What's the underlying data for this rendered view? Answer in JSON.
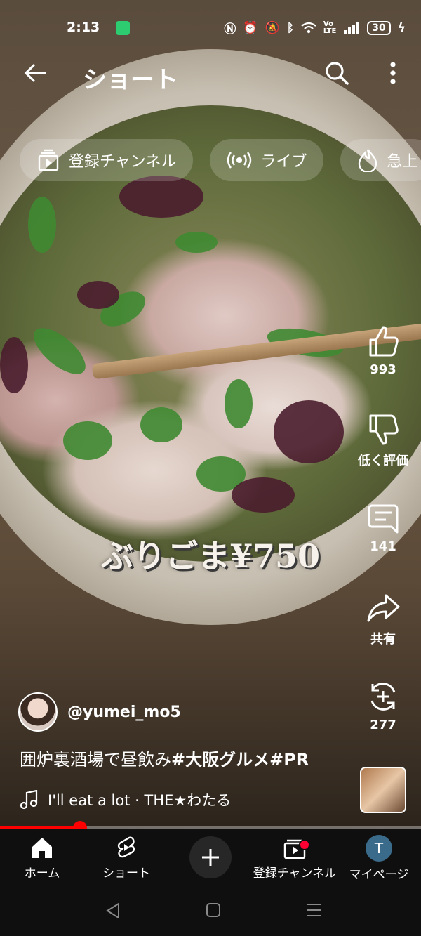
{
  "status_bar": {
    "time": "2:13",
    "battery": "30"
  },
  "header": {
    "title": "ショート"
  },
  "chips": [
    {
      "label": "登録チャンネル",
      "icon": "subscriptions-icon"
    },
    {
      "label": "ライブ",
      "icon": "live-icon"
    },
    {
      "label": "急上",
      "icon": "trending-icon"
    }
  ],
  "video": {
    "overlay_text": "ぶりごま¥750"
  },
  "actions": {
    "like_count": "993",
    "dislike_label": "低く評価",
    "comment_count": "141",
    "share_label": "共有",
    "remix_count": "277"
  },
  "channel": {
    "handle": "@yumei_mo5"
  },
  "caption": {
    "text": "囲炉裏酒場で昼飲み",
    "hashtags": "#大阪グルメ#PR"
  },
  "music": {
    "text": "I'll eat a lot · THE★わたる"
  },
  "progress": {
    "fraction": 0.19
  },
  "nav": {
    "home": "ホーム",
    "shorts": "ショート",
    "subscriptions": "登録チャンネル",
    "me": "マイページ",
    "avatar_letter": "T"
  },
  "colors": {
    "accent": "#ff0000",
    "nav_bg": "#0f0f0f"
  }
}
